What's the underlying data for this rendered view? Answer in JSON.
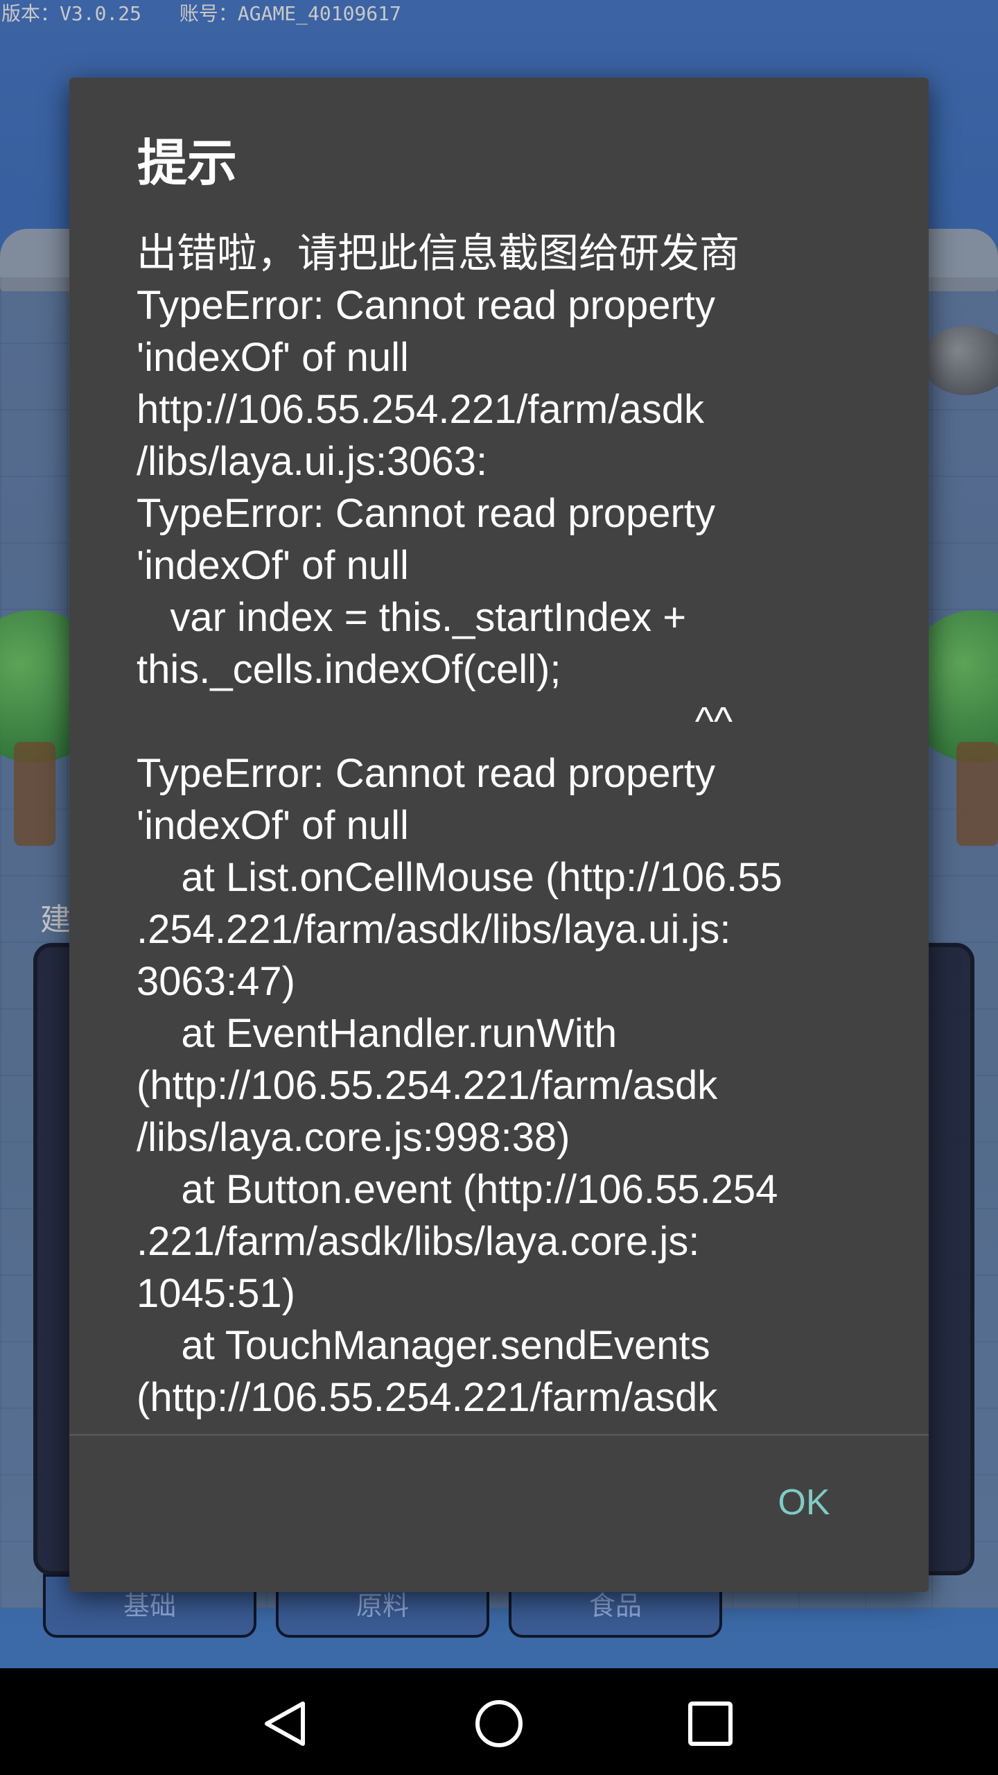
{
  "header": {
    "version": "版本：V3.0.25",
    "account": "账号：AGAME_40109617"
  },
  "background": {
    "panel_label": "建",
    "tabs": [
      "基础",
      "原料",
      "食品"
    ]
  },
  "dialog": {
    "title": "提示",
    "message": "出错啦，请把此信息截图给研发商\nTypeError: Cannot read property\n'indexOf' of null\nhttp://106.55.254.221/farm/asdk\n/libs/laya.ui.js:3063:\nTypeError: Cannot read property\n'indexOf' of null\n   var index = this._startIndex +\nthis._cells.indexOf(cell);\n                                                  ^^\nTypeError: Cannot read property\n'indexOf' of null\n    at List.onCellMouse (http://106.55\n.254.221/farm/asdk/libs/laya.ui.js:\n3063:47)\n    at EventHandler.runWith\n(http://106.55.254.221/farm/asdk\n/libs/laya.core.js:998:38)\n    at Button.event (http://106.55.254\n.221/farm/asdk/libs/laya.core.js:\n1045:51)\n    at TouchManager.sendEvents\n(http://106.55.254.221/farm/asdk",
    "ok_label": "OK"
  },
  "colors": {
    "dialog_bg": "#424242",
    "text": "#ffffff",
    "accent": "#80cbc4",
    "nav_bar": "#000000"
  },
  "navigation": {
    "back_icon": "back-triangle-icon",
    "home_icon": "home-circle-icon",
    "recents_icon": "recents-square-icon"
  }
}
